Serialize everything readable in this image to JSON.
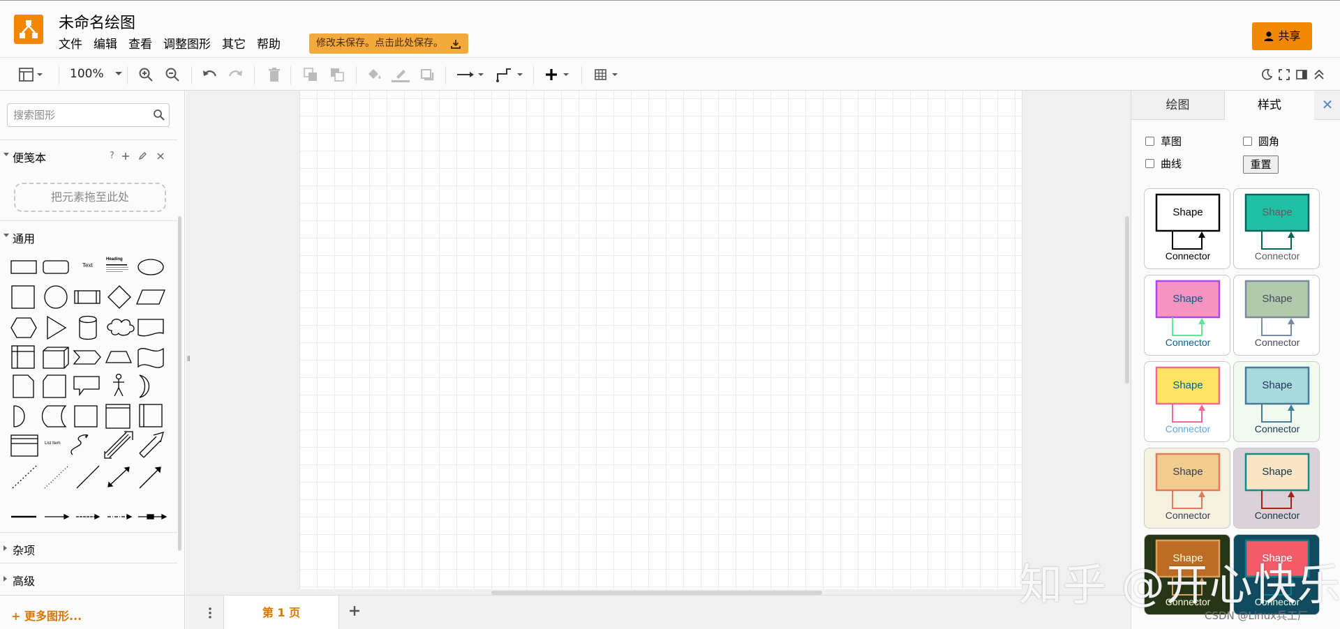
{
  "app": {
    "doc_title": "未命名绘图",
    "menus": [
      "文件",
      "编辑",
      "查看",
      "调整图形",
      "其它",
      "帮助"
    ],
    "save_notice": "修改未保存。点击此处保存。",
    "share_label": "共享"
  },
  "toolbar": {
    "zoom": "100%",
    "icons": [
      "format-panel-icon",
      "zoom-in-icon",
      "zoom-out-icon",
      "undo-icon",
      "redo-icon",
      "delete-icon",
      "to-front-icon",
      "to-back-icon",
      "fill-color-icon",
      "line-color-icon",
      "shadow-icon",
      "connection-icon",
      "waypoints-icon",
      "insert-icon",
      "table-icon",
      "dark-mode-icon",
      "fullscreen-icon",
      "toggle-format-icon",
      "collapse-icon"
    ]
  },
  "sidebar": {
    "search_placeholder": "搜索图形",
    "scratchpad_title": "便笺本",
    "scratchpad_help": "?",
    "scratchpad_drop": "把元素拖至此处",
    "general_title": "通用",
    "shape_text_sample": "Text",
    "shape_heading_sample": "Heading",
    "shape_list_item_sample": "List Item",
    "misc_title": "杂项",
    "advanced_title": "高级",
    "more_shapes": "更多图形..."
  },
  "pages": {
    "tab_label": "第 1 页"
  },
  "format_panel": {
    "tab_diagram": "绘图",
    "tab_style": "样式",
    "close": "✕",
    "option_sketch": "草图",
    "option_rounded": "圆角",
    "option_curved": "曲线",
    "reset_label": "重置",
    "styles": [
      {
        "shape": "Shape",
        "connector": "Connector",
        "fill": "#ffffff",
        "stroke": "#000000",
        "line": "#000000",
        "text": "#000000",
        "bg": "#ffffff",
        "conn_text": "#000000"
      },
      {
        "shape": "Shape",
        "connector": "Connector",
        "fill": "#21c0a5",
        "stroke": "#006658",
        "line": "#006658",
        "text": "#5c5c5c",
        "bg": "#ffffff",
        "conn_text": "#5c5c5c"
      },
      {
        "shape": "Shape",
        "connector": "Connector",
        "fill": "#f694c1",
        "stroke": "#af45ed",
        "line": "#60e696",
        "text": "#095c86",
        "bg": "#ffffff",
        "conn_text": "#095c86"
      },
      {
        "shape": "Shape",
        "connector": "Connector",
        "fill": "#b2c9ab",
        "stroke": "#788aa3",
        "line": "#788aa3",
        "text": "#46495d",
        "bg": "#ffffff",
        "conn_text": "#46495d"
      },
      {
        "shape": "Shape",
        "connector": "Connector",
        "fill": "#fee465",
        "stroke": "#ee6a92",
        "line": "#ee6a92",
        "text": "#095c86",
        "bg": "#ffffff",
        "conn_text": "#5aa9e6"
      },
      {
        "shape": "Shape",
        "connector": "Connector",
        "fill": "#a8dadc",
        "stroke": "#457b9d",
        "line": "#457b9d",
        "text": "#1d3557",
        "bg": "#f1faee",
        "conn_text": "#1d3557"
      },
      {
        "shape": "Shape",
        "connector": "Connector",
        "fill": "#f2cc8f",
        "stroke": "#e07a5f",
        "line": "#e07a5f",
        "text": "#393c56",
        "bg": "#f4f1de",
        "conn_text": "#393c56"
      },
      {
        "shape": "Shape",
        "connector": "Connector",
        "fill": "#fae5c7",
        "stroke": "#0f8b8d",
        "line": "#a8201a",
        "text": "#143642",
        "bg": "#dad2d8",
        "conn_text": "#143642"
      },
      {
        "shape": "Shape",
        "connector": "Connector",
        "fill": "#bc6c25",
        "stroke": "#dda15e",
        "line": "#dda15e",
        "text": "#fefae0",
        "bg": "#283618",
        "conn_text": "#fefae0"
      },
      {
        "shape": "Shape",
        "connector": "Connector",
        "fill": "#f45b69",
        "stroke": "#028090",
        "line": "#028090",
        "text": "#ffffff",
        "bg": "#114b5f",
        "conn_text": "#e4fde1"
      }
    ]
  },
  "colors": {
    "brand": "#f08705",
    "save_notice_bg": "#f4a93d",
    "accent_text": "#d97706"
  },
  "watermark": {
    "text": "知乎 @开心快乐",
    "csdn": "CSDN @Linux兵工厂"
  }
}
